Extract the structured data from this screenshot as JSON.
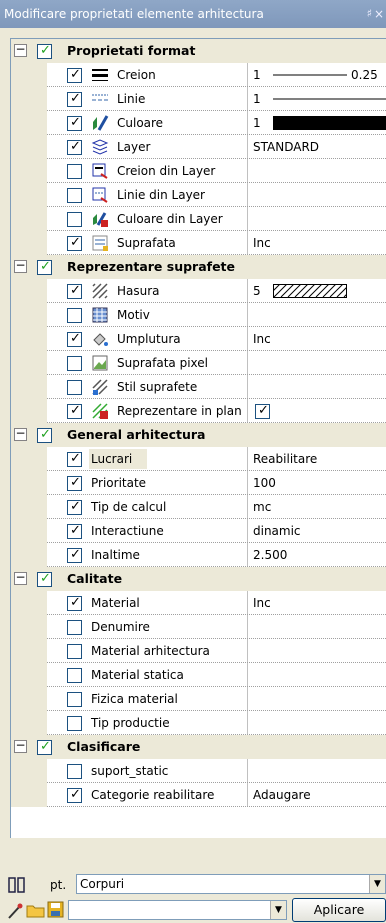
{
  "window": {
    "title": "Modificare proprietati elemente arhitectura",
    "pin": "♯",
    "close": "×"
  },
  "sections": [
    {
      "title": "Proprietati format",
      "checked": true,
      "items": [
        {
          "label": "Creion",
          "checked": true,
          "icon": "pen-thickness-icon",
          "value": "1",
          "value2": "0.25",
          "value_type": "line"
        },
        {
          "label": "Linie",
          "checked": true,
          "icon": "line-type-icon",
          "value": "1",
          "value_type": "line2"
        },
        {
          "label": "Culoare",
          "checked": true,
          "icon": "color-icon",
          "value": "1",
          "value_type": "color"
        },
        {
          "label": "Layer",
          "checked": true,
          "icon": "layer-icon",
          "value": "STANDARD"
        },
        {
          "label": "Creion din Layer",
          "checked": false,
          "icon": "pen-from-layer-icon",
          "value": ""
        },
        {
          "label": "Linie din Layer",
          "checked": false,
          "icon": "line-from-layer-icon",
          "value": ""
        },
        {
          "label": "Culoare din Layer",
          "checked": false,
          "icon": "color-from-layer-icon",
          "value": ""
        },
        {
          "label": "Suprafata",
          "checked": true,
          "icon": "surface-icon",
          "value": "Inc"
        }
      ]
    },
    {
      "title": "Reprezentare suprafete",
      "checked": true,
      "items": [
        {
          "label": "Hasura",
          "checked": true,
          "icon": "hatch-icon",
          "value": "5",
          "value_type": "hatch"
        },
        {
          "label": "Motiv",
          "checked": false,
          "icon": "pattern-icon",
          "value": ""
        },
        {
          "label": "Umplutura",
          "checked": true,
          "icon": "fill-icon",
          "value": "Inc"
        },
        {
          "label": "Suprafata pixel",
          "checked": false,
          "icon": "pixel-surface-icon",
          "value": ""
        },
        {
          "label": "Stil suprafete",
          "checked": false,
          "icon": "surface-style-icon",
          "value": ""
        },
        {
          "label": "Reprezentare in plan",
          "checked": true,
          "icon": "plan-representation-icon",
          "value": "",
          "value_type": "checkbox"
        }
      ]
    },
    {
      "title": "General arhitectura",
      "checked": true,
      "items": [
        {
          "label": "Lucrari",
          "checked": true,
          "value": "Reabilitare",
          "highlight": true
        },
        {
          "label": "Prioritate",
          "checked": true,
          "value": "100"
        },
        {
          "label": "Tip de calcul",
          "checked": true,
          "value": "mc"
        },
        {
          "label": "Interactiune",
          "checked": true,
          "value": "dinamic"
        },
        {
          "label": "Inaltime",
          "checked": true,
          "value": "2.500"
        }
      ]
    },
    {
      "title": "Calitate",
      "checked": true,
      "items": [
        {
          "label": "Material",
          "checked": true,
          "value": "Inc"
        },
        {
          "label": "Denumire",
          "checked": false,
          "value": ""
        },
        {
          "label": "Material arhitectura",
          "checked": false,
          "value": ""
        },
        {
          "label": "Material statica",
          "checked": false,
          "value": ""
        },
        {
          "label": "Fizica material",
          "checked": false,
          "value": ""
        },
        {
          "label": "Tip productie",
          "checked": false,
          "value": ""
        }
      ]
    },
    {
      "title": "Clasificare",
      "checked": true,
      "items": [
        {
          "label": "suport_static",
          "checked": false,
          "value": ""
        },
        {
          "label": "Categorie reabilitare",
          "checked": true,
          "value": "Adaugare"
        }
      ]
    }
  ],
  "bottom": {
    "pt_label": "pt.",
    "scope_value": "Corpuri",
    "combo_value": "",
    "apply_label": "Aplicare"
  },
  "colors": {
    "title_bar": "#7f98bb",
    "panel": "#ece9d8",
    "border": "#7f9db9",
    "color_swatch": "#000000"
  }
}
